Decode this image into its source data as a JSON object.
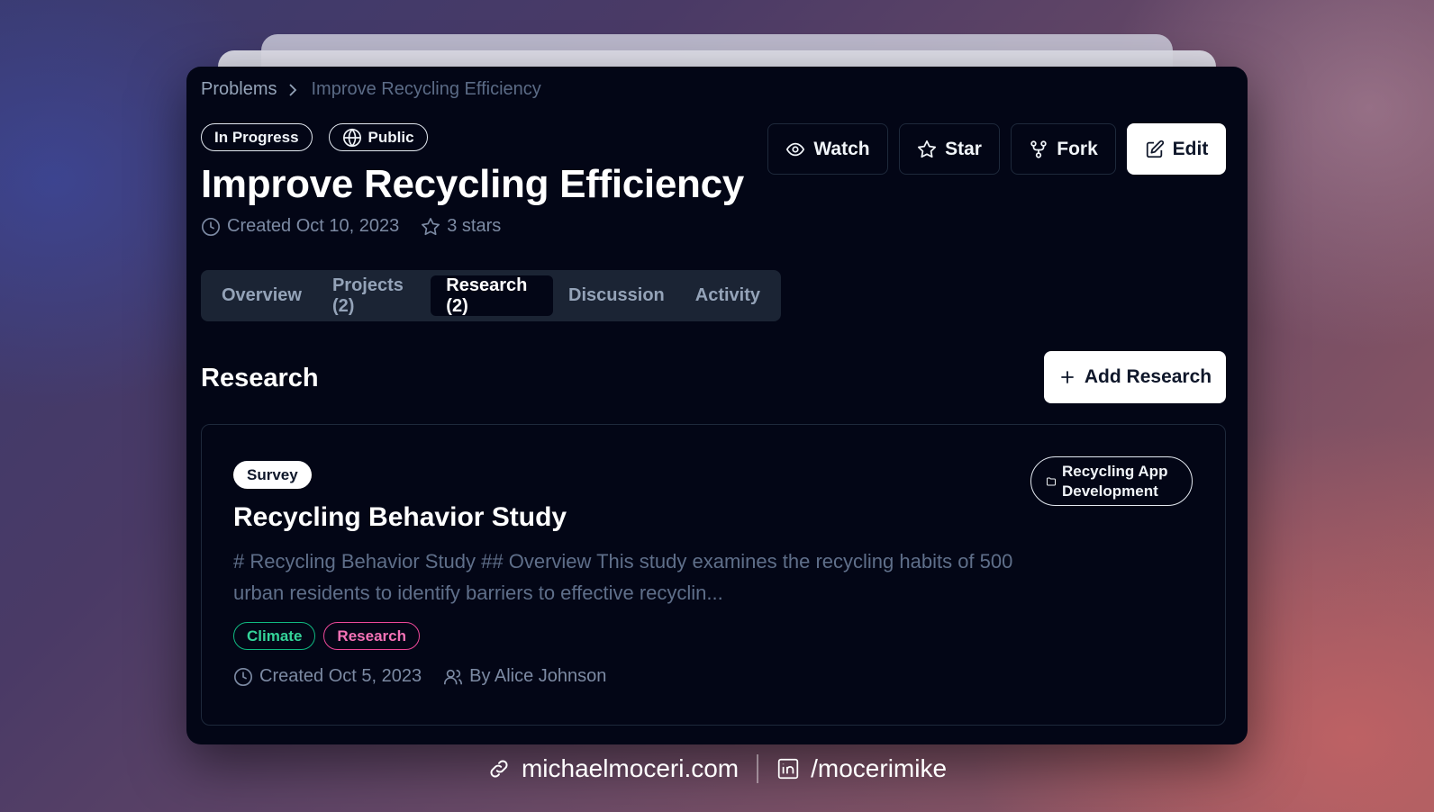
{
  "breadcrumb": {
    "root": "Problems",
    "current": "Improve Recycling Efficiency"
  },
  "badges": {
    "status": "In Progress",
    "visibility": "Public"
  },
  "problem": {
    "title": "Improve Recycling Efficiency",
    "created": "Created Oct 10, 2023",
    "stars": "3 stars"
  },
  "actions": {
    "watch": "Watch",
    "star": "Star",
    "fork": "Fork",
    "edit": "Edit"
  },
  "tabs": [
    {
      "label": "Overview"
    },
    {
      "label": "Projects (2)"
    },
    {
      "label": "Research (2)",
      "active": true
    },
    {
      "label": "Discussion"
    },
    {
      "label": "Activity"
    }
  ],
  "section": {
    "title": "Research",
    "add_label": "Add Research"
  },
  "research_card": {
    "type": "Survey",
    "project_line1": "Recycling App",
    "project_line2": "Development",
    "title": "Recycling Behavior Study",
    "description": "# Recycling Behavior Study ## Overview This study examines the recycling habits of 500 urban residents to identify barriers to effective recyclin...",
    "tags": [
      "Climate",
      "Research"
    ],
    "created": "Created Oct 5, 2023",
    "author": "By Alice Johnson"
  },
  "footer": {
    "website": "michaelmoceri.com",
    "linkedin": "/mocerimike"
  },
  "colors": {
    "background": "#030616",
    "tab_bar": "#1b2434",
    "tag_green": "#10b981",
    "tag_pink": "#ec4899"
  },
  "icons": [
    "clock-icon",
    "star-icon",
    "globe-icon",
    "eye-icon",
    "fork-icon",
    "edit-icon",
    "plus-icon",
    "folder-icon",
    "users-icon",
    "link-icon",
    "linkedin-icon",
    "chevron-right-icon"
  ]
}
